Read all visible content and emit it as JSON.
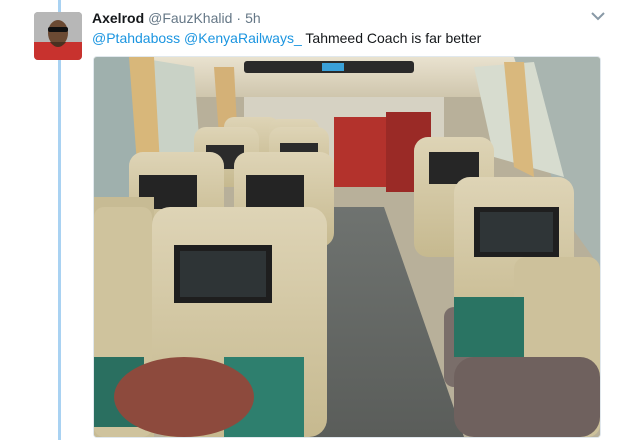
{
  "tweet": {
    "author_name": "Axelrod",
    "author_handle": "@FauzKhalid",
    "separator": "·",
    "time": "5h",
    "mentions": [
      "@Ptahdaboss",
      "@KenyaRailways_"
    ],
    "text": "Tahmeed Coach is far better",
    "avatar_icon": "user-avatar",
    "menu_icon": "chevron-down-icon",
    "media_subject": "bus interior with beige reclining seats and seatback screens"
  },
  "colors": {
    "link": "#1b95e0",
    "thread_line": "#a9d2f2",
    "text_primary": "#14171a",
    "text_secondary": "#657786"
  }
}
